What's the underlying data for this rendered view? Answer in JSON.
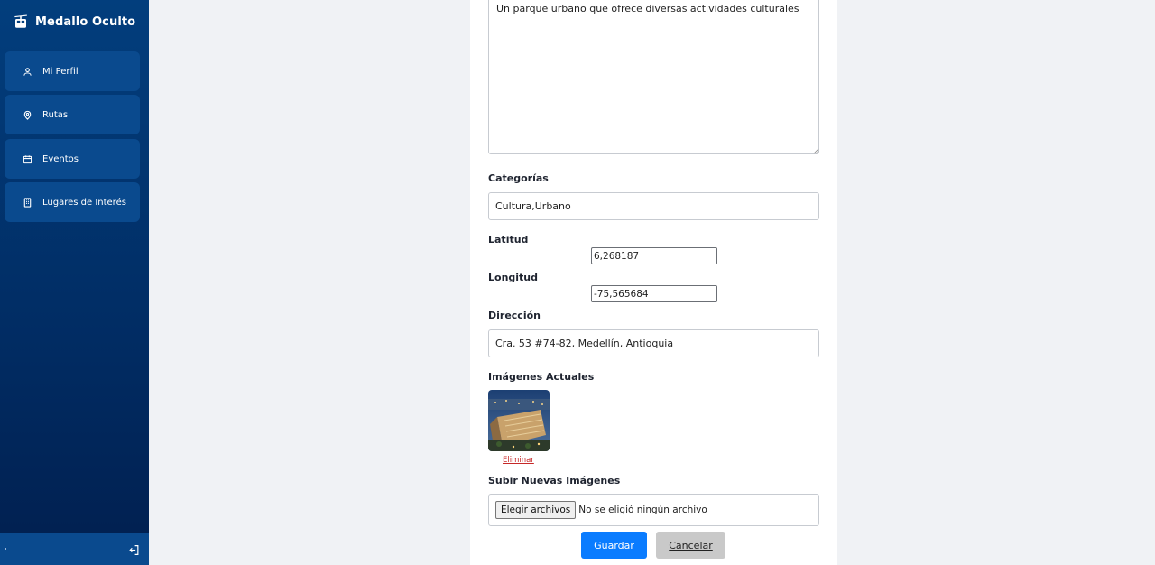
{
  "app": {
    "title": "Medallo Oculto",
    "logo_icon": "cable-car-icon"
  },
  "sidebar": {
    "items": [
      {
        "label": "Mi Perfil",
        "icon": "user-icon"
      },
      {
        "label": "Rutas",
        "icon": "map-pin-icon"
      },
      {
        "label": "Eventos",
        "icon": "calendar-icon"
      },
      {
        "label": "Lugares de Interés",
        "icon": "building-icon"
      }
    ],
    "logout_icon": "logout-icon"
  },
  "form": {
    "description_value": "Un parque urbano que ofrece diversas actividades culturales",
    "categories_label": "Categorías",
    "categories_value": "Cultura,Urbano",
    "latitude_label": "Latitud",
    "latitude_value": "6,268187",
    "longitude_label": "Longitud",
    "longitude_value": "-75,565684",
    "address_label": "Dirección",
    "address_value": "Cra. 53 #74-82, Medellín, Antioquia",
    "current_images_label": "Imágenes Actuales",
    "remove_label": "Eliminar",
    "upload_label": "Subir Nuevas Imágenes",
    "file_button_label": "Elegir archivos",
    "file_status": "No se eligió ningún archivo",
    "save_label": "Guardar",
    "cancel_label": "Cancelar"
  },
  "colors": {
    "sidebar": "#023e7d",
    "nav_item": "#0a4a8e",
    "primary": "#0a7cff",
    "danger": "#c62828"
  }
}
